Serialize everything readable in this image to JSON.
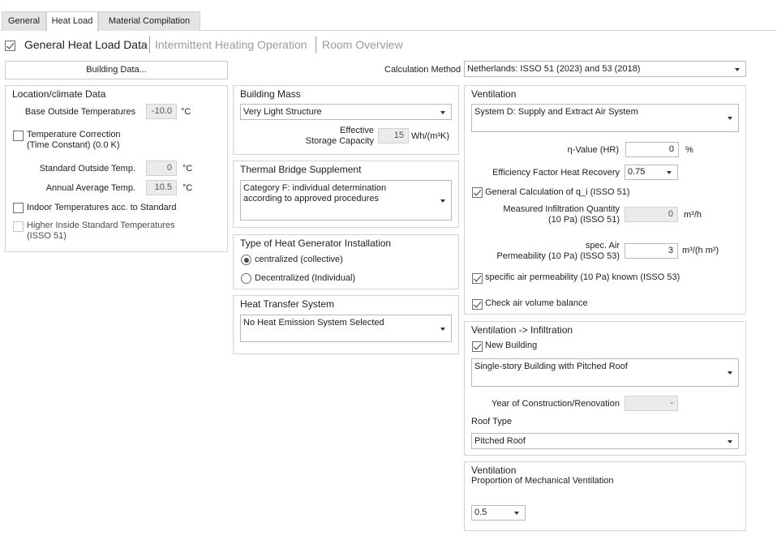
{
  "tabs": [
    "General",
    "Heat Load",
    "Material Compilation"
  ],
  "subtabs": [
    "General Heat Load Data",
    "Intermittent Heating Operation",
    "Room Overview"
  ],
  "building_data_button": "Building Data...",
  "calc_method": {
    "label": "Calculation Method",
    "value": "Netherlands: ISSO 51 (2023) and 53 (2018)"
  },
  "location": {
    "title": "Location/climate Data",
    "base_outside_label": "Base Outside Temperatures",
    "base_outside_value": "-10.0",
    "base_outside_unit": "°C",
    "temp_correction_line1": "Temperature Correction",
    "temp_correction_line2": "(Time Constant) (0.0 K)",
    "standard_outside_label": "Standard Outside Temp.",
    "standard_outside_value": "0",
    "standard_outside_unit": "°C",
    "annual_avg_label": "Annual Average Temp.",
    "annual_avg_value": "10.5",
    "annual_avg_unit": "°C",
    "indoor_temps_label": "Indoor Temperatures acc. to Standard",
    "higher_inside_line1": "Higher Inside Standard Temperatures",
    "higher_inside_line2": "(ISSO 51)"
  },
  "building_mass": {
    "title": "Building Mass",
    "value": "Very Light Structure",
    "storage_line1": "Effective",
    "storage_line2": "Storage Capacity",
    "storage_value": "15",
    "storage_unit": "Wh/(m³K)"
  },
  "thermal_bridge": {
    "title": "Thermal Bridge Supplement",
    "line1": "Category F: individual determination",
    "line2": "according to approved procedures"
  },
  "heat_generator": {
    "title": "Type of Heat Generator Installation",
    "option1": "centralized (collective)",
    "option2": "Decentralized (Individual)"
  },
  "heat_transfer": {
    "title": "Heat Transfer System",
    "value": "No Heat Emission System Selected"
  },
  "ventilation": {
    "title": "Ventilation",
    "system": "System D: Supply and Extract Air System",
    "eta_label": "η-Value (HR)",
    "eta_value": "0",
    "eta_unit": "%",
    "efficiency_label": "Efficiency Factor Heat Recovery",
    "efficiency_value": "0.75",
    "general_calc_label": "General Calculation of q_i (ISSO 51)",
    "infiltration_line1": "Measured Infiltration Quantity",
    "infiltration_line2": "(10 Pa) (ISSO 51)",
    "infiltration_value": "0",
    "infiltration_unit": "m³/h",
    "permeability_line1": "spec. Air",
    "permeability_line2": "Permeability (10 Pa) (ISSO 53)",
    "permeability_value": "3",
    "permeability_unit": "m³/(h m²)",
    "specific_known_label": "specific air permeability (10 Pa) known (ISSO 53)",
    "check_balance_label": "Check air volume balance"
  },
  "vent_infiltration": {
    "title": "Ventilation -> Infiltration",
    "new_building_label": "New Building",
    "building_type": "Single-story Building with Pitched Roof",
    "year_label": "Year of Construction/Renovation",
    "year_value": "-",
    "roof_type_label": "Roof Type",
    "roof_type_value": "Pitched Roof"
  },
  "ventilation2": {
    "title": "Ventilation",
    "proportion_label": "Proportion of Mechanical Ventilation",
    "proportion_value": "0.5"
  }
}
